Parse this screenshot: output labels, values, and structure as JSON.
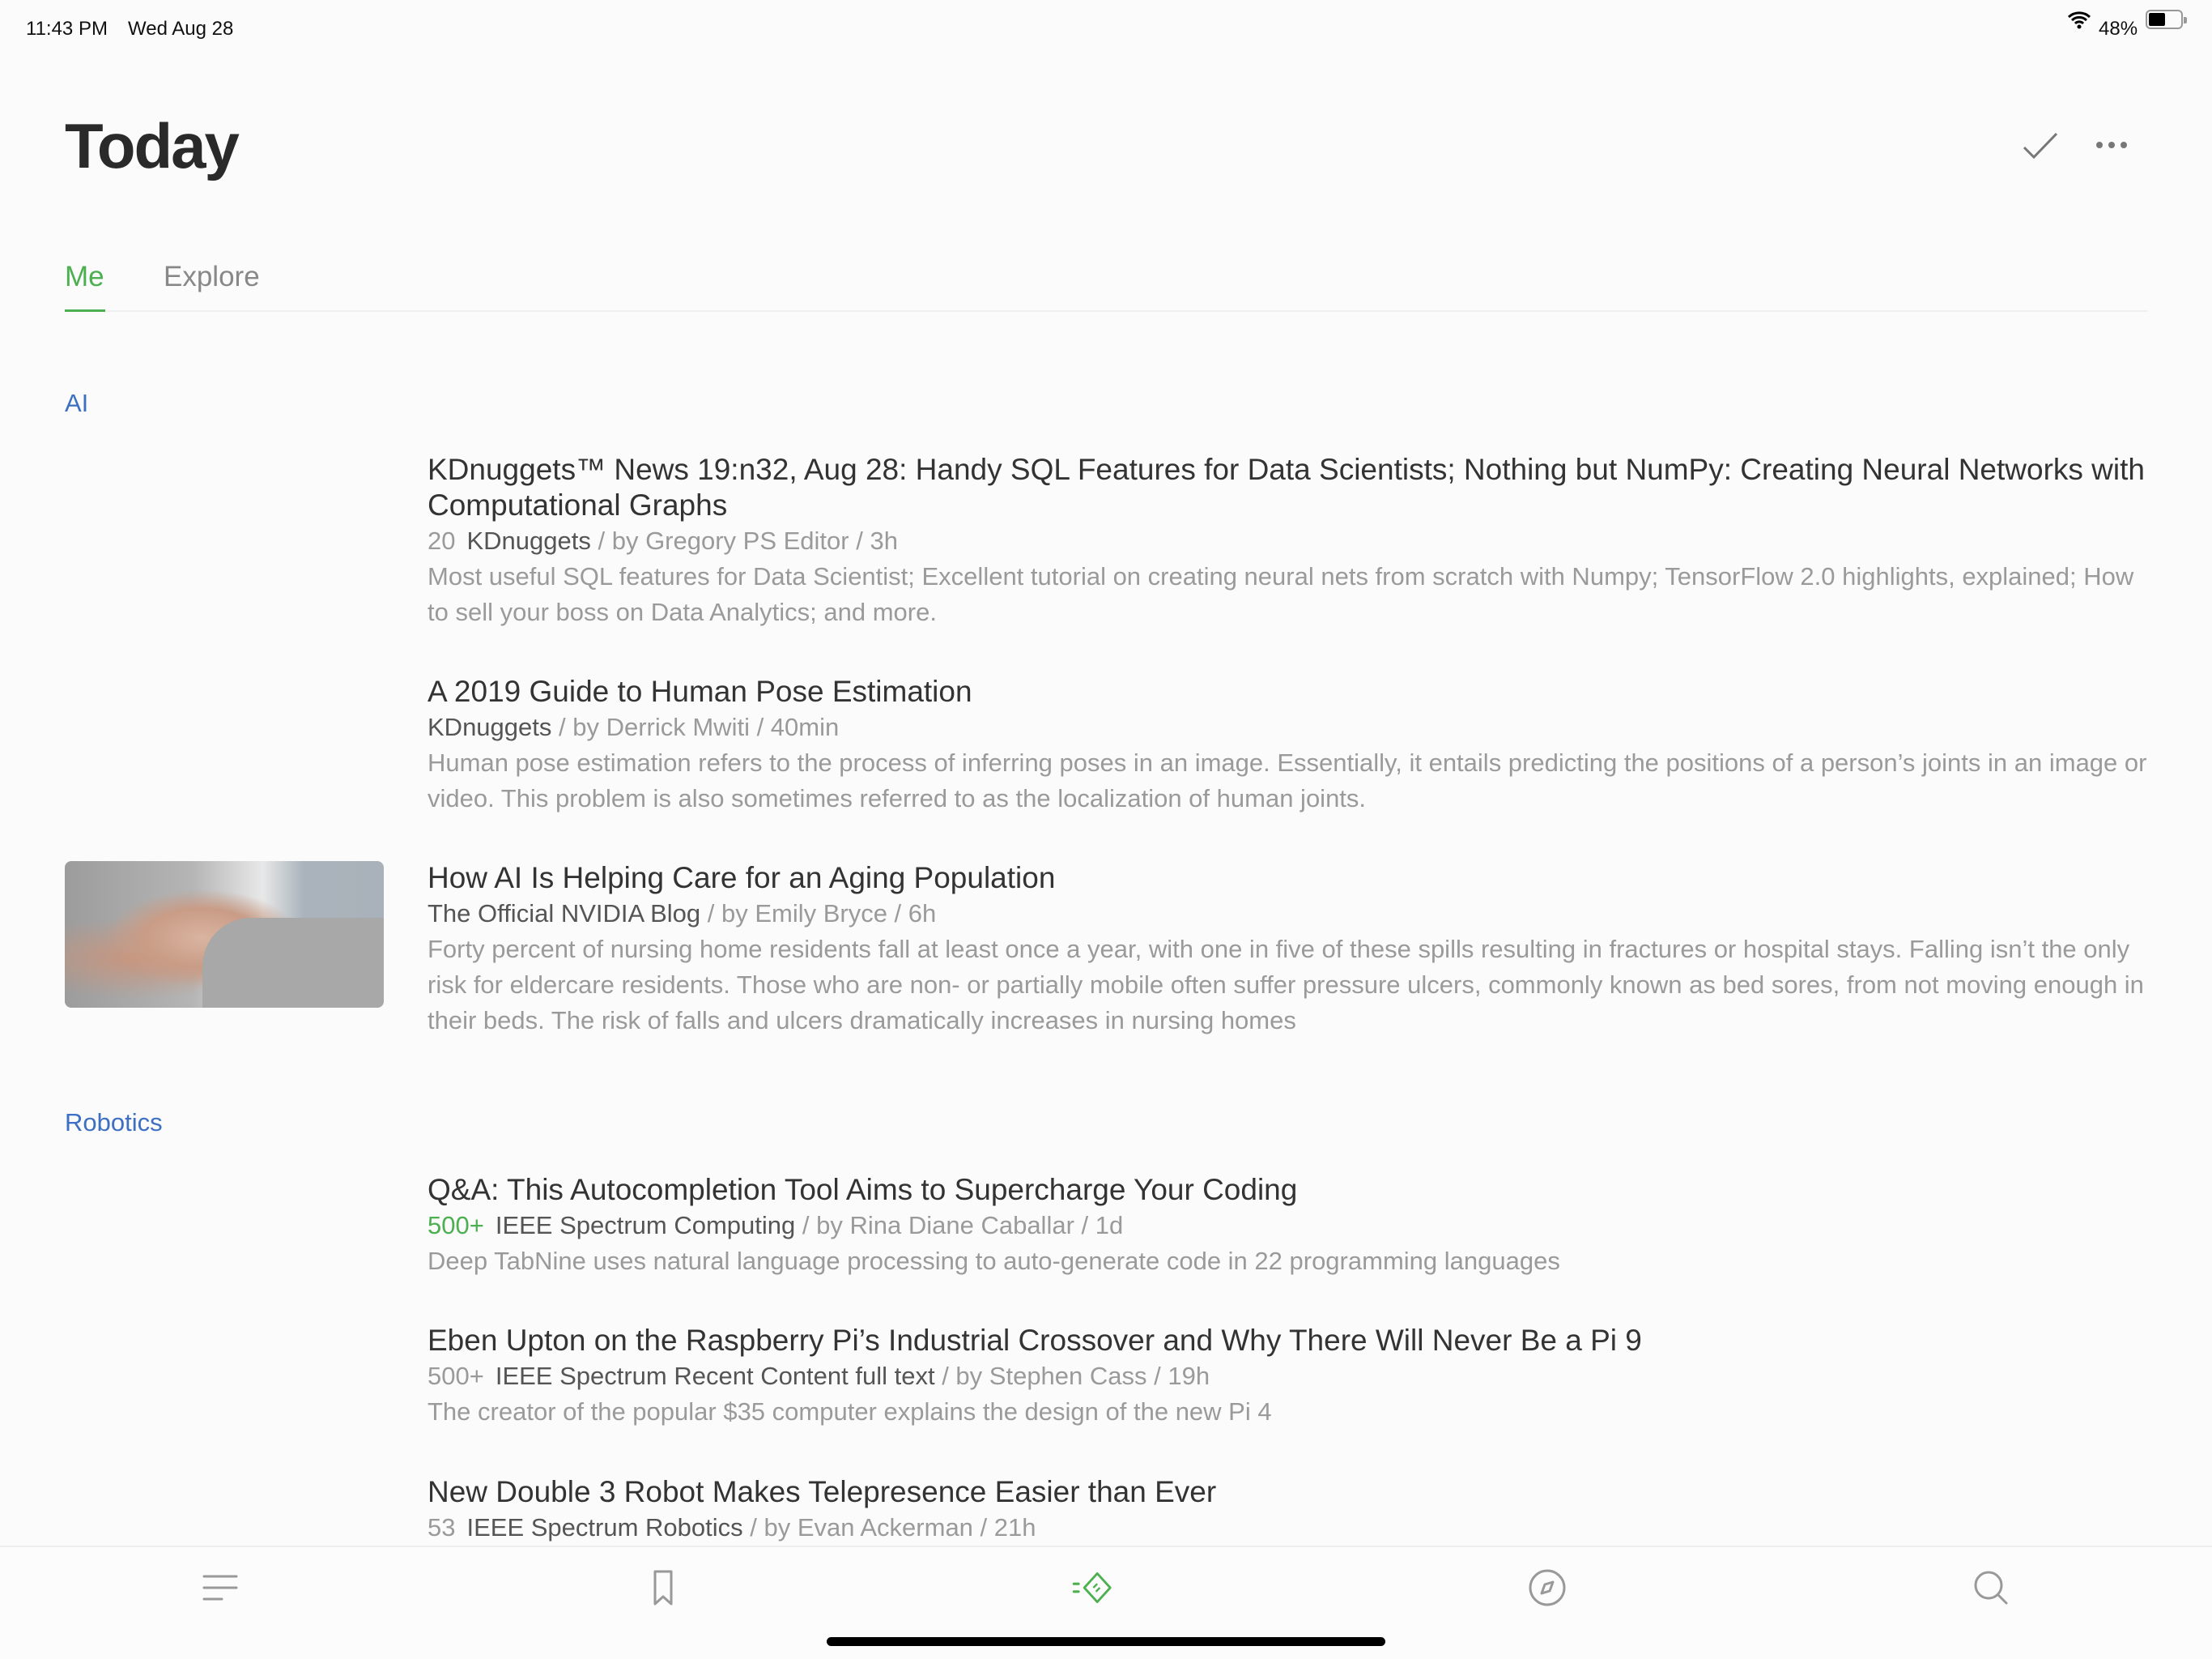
{
  "status_bar": {
    "time": "11:43 PM",
    "date": "Wed Aug 28",
    "battery": "48%",
    "battery_level": 0.48
  },
  "header": {
    "title": "Today"
  },
  "tabs": [
    {
      "label": "Me",
      "active": true
    },
    {
      "label": "Explore",
      "active": false
    }
  ],
  "colors": {
    "accent": "#4caf50",
    "section": "#3d6fc2"
  },
  "sections": [
    {
      "title": "AI",
      "items": [
        {
          "title": "KDnuggets™ News 19:n32, Aug 28: Handy SQL Features for Data Scientists; Nothing but NumPy: Creating Neural Networks with Computational Graphs",
          "count": "20",
          "source": "KDnuggets",
          "meta": " / by Gregory PS Editor / 3h",
          "summary": "Most useful SQL features for Data Scientist; Excellent tutorial on creating neural nets from scratch with Numpy; TensorFlow 2.0 highlights, explained; How to sell your boss on Data Analytics; and more."
        },
        {
          "title": "A 2019 Guide to Human Pose Estimation",
          "count": "",
          "source": "KDnuggets",
          "meta": " / by Derrick Mwiti / 40min",
          "summary": "Human pose estimation refers to the process of inferring poses in an image. Essentially, it entails predicting the positions of a person’s joints in an image or video. This problem is also sometimes referred to as the localization of human joints."
        },
        {
          "title": "How AI Is Helping Care for an Aging Population",
          "count": "",
          "source": "The Official NVIDIA Blog",
          "meta": " / by Emily Bryce / 6h",
          "summary": "Forty percent of nursing home residents fall at least once a year, with one in five of these spills resulting in fractures or hospital stays. Falling isn’t the only risk for eldercare residents. Those who are non- or partially mobile often suffer pressure ulcers, commonly known as bed sores, from not moving enough in their beds. The risk of falls and ulcers dramatically increases in nursing homes"
        }
      ]
    },
    {
      "title": "Robotics",
      "items": [
        {
          "title": "Q&A: This Autocompletion Tool Aims to Supercharge Your Coding",
          "count": "500+",
          "source": "IEEE Spectrum Computing",
          "meta": " / by Rina Diane Caballar / 1d",
          "summary": "Deep TabNine uses natural language processing to auto-generate code in 22 programming languages"
        },
        {
          "title": "Eben Upton on the Raspberry Pi’s Industrial Crossover and Why There Will Never Be a Pi 9",
          "count": "500+",
          "source": "IEEE Spectrum Recent Content full text",
          "meta": " / by Stephen Cass / 19h",
          "summary": "The creator of the popular $35 computer explains the design of the new Pi 4"
        },
        {
          "title": "New Double 3 Robot Makes Telepresence Easier than Ever",
          "count": "53",
          "source": "IEEE Spectrum Robotics",
          "meta": " / by Evan Ackerman / 21h",
          "summary": ""
        }
      ]
    }
  ],
  "bottom_nav": [
    {
      "icon": "menu-icon"
    },
    {
      "icon": "bookmark-icon"
    },
    {
      "icon": "feedly-today-icon",
      "active": true
    },
    {
      "icon": "compass-icon"
    },
    {
      "icon": "search-icon"
    }
  ]
}
